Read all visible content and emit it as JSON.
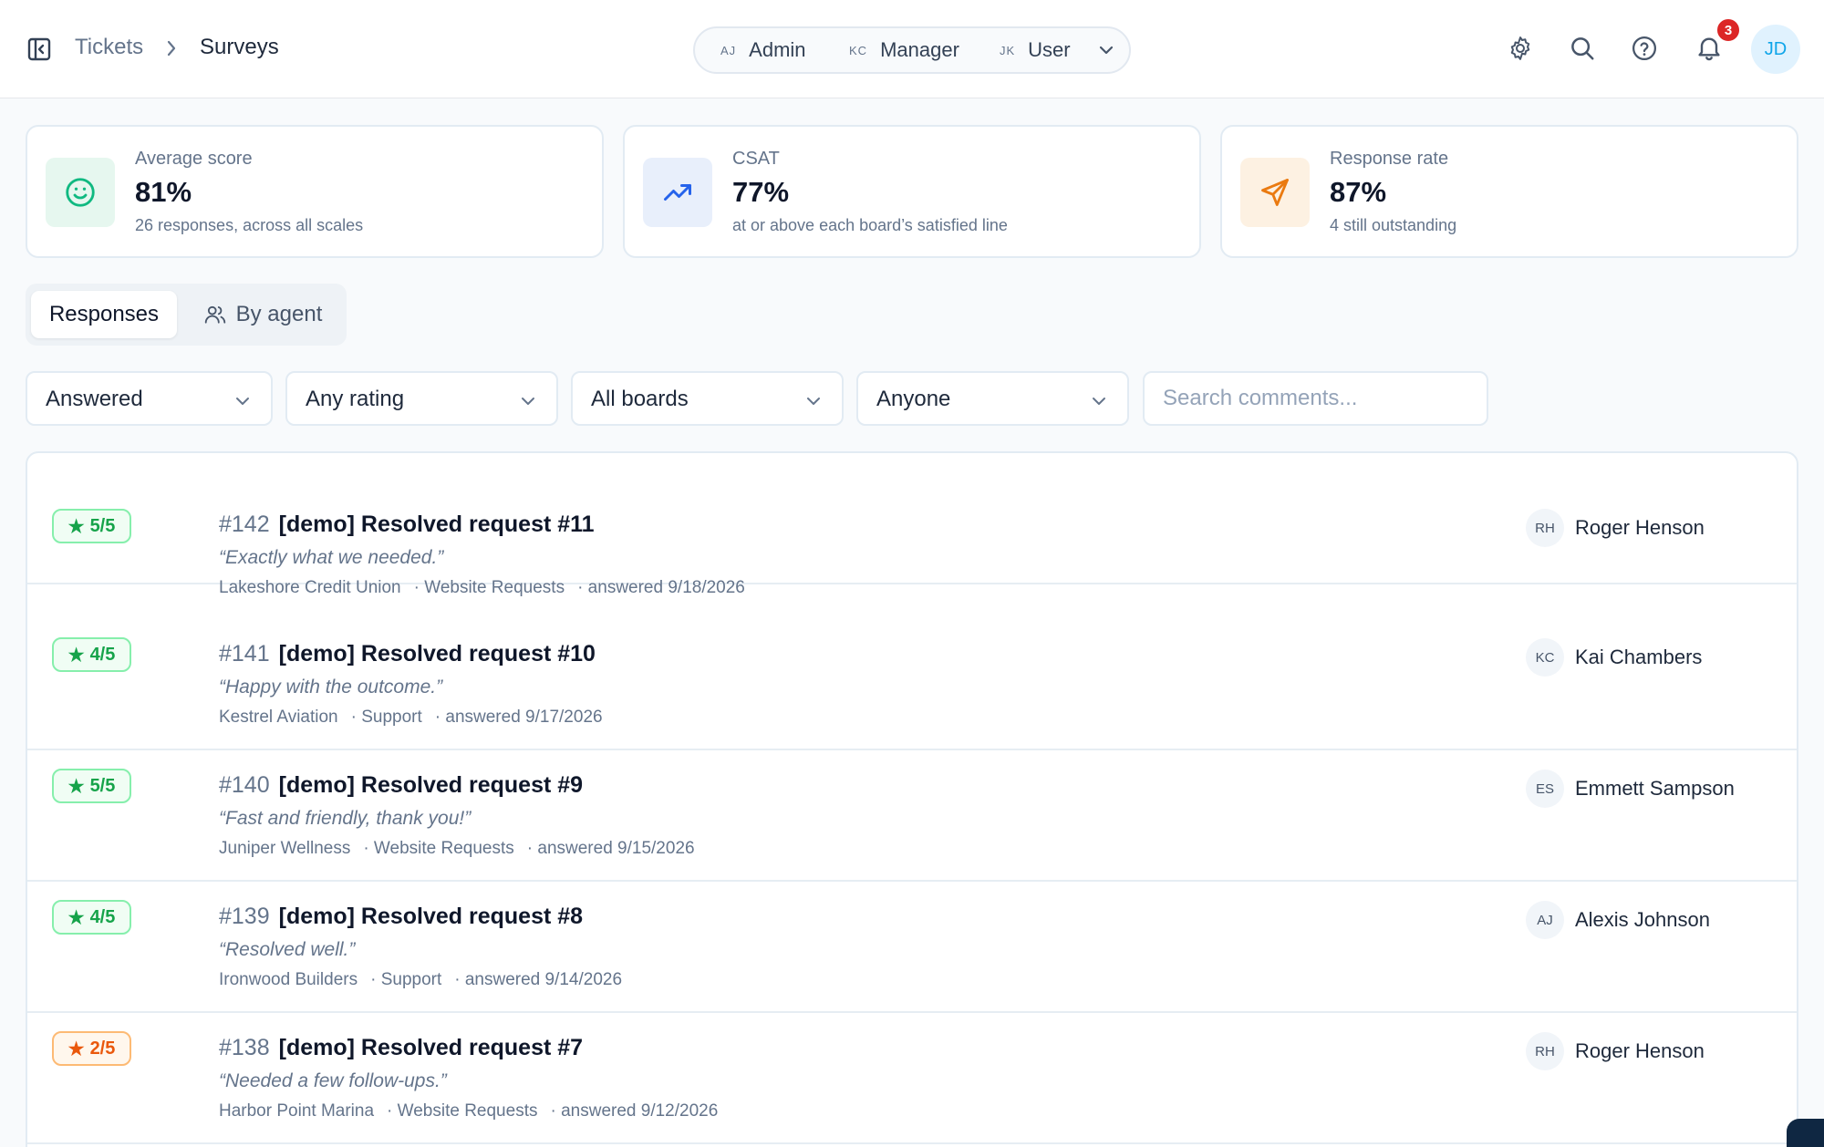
{
  "breadcrumb": {
    "parent": "Tickets",
    "current": "Surveys"
  },
  "roles": [
    {
      "initials": "AJ",
      "label": "Admin"
    },
    {
      "initials": "KC",
      "label": "Manager"
    },
    {
      "initials": "JK",
      "label": "User"
    }
  ],
  "notifications": {
    "count": "3"
  },
  "user": {
    "initials": "JD"
  },
  "stats": [
    {
      "label": "Average score",
      "value": "81%",
      "sub": "26 responses, across all scales",
      "icon": "smile-icon",
      "accent": "#10b981",
      "bg": "#e6f7ef"
    },
    {
      "label": "CSAT",
      "value": "77%",
      "sub": "at or above each board’s satisfied line",
      "icon": "trending-up-icon",
      "accent": "#2563eb",
      "bg": "#e8effb"
    },
    {
      "label": "Response rate",
      "value": "87%",
      "sub": "4 still outstanding",
      "icon": "send-icon",
      "accent": "#ea7a10",
      "bg": "#fdf1e2"
    }
  ],
  "tabs": {
    "active": "Responses",
    "inactive": "By agent"
  },
  "filters": {
    "status": "Answered",
    "rating": "Any rating",
    "board": "All boards",
    "agent": "Anyone",
    "search_placeholder": "Search comments..."
  },
  "responses": [
    {
      "rating": "5/5",
      "tone": "good",
      "number": "#142",
      "subject": "[demo] Resolved request #11",
      "comment": "“Exactly what we needed.”",
      "company": "Lakeshore Credit Union",
      "board": "· Website Requests",
      "answered": "· answered 9/18/2026",
      "agent_initials": "RH",
      "agent": "Roger Henson"
    },
    {
      "rating": "4/5",
      "tone": "good",
      "number": "#141",
      "subject": "[demo] Resolved request #10",
      "comment": "“Happy with the outcome.”",
      "company": "Kestrel Aviation",
      "board": "· Support",
      "answered": "· answered 9/17/2026",
      "agent_initials": "KC",
      "agent": "Kai Chambers"
    },
    {
      "rating": "5/5",
      "tone": "good",
      "number": "#140",
      "subject": "[demo] Resolved request #9",
      "comment": "“Fast and friendly, thank you!”",
      "company": "Juniper Wellness",
      "board": "· Website Requests",
      "answered": "· answered 9/15/2026",
      "agent_initials": "ES",
      "agent": "Emmett Sampson"
    },
    {
      "rating": "4/5",
      "tone": "good",
      "number": "#139",
      "subject": "[demo] Resolved request #8",
      "comment": "“Resolved well.”",
      "company": "Ironwood Builders",
      "board": "· Support",
      "answered": "· answered 9/14/2026",
      "agent_initials": "AJ",
      "agent": "Alexis Johnson"
    },
    {
      "rating": "2/5",
      "tone": "poor",
      "number": "#138",
      "subject": "[demo] Resolved request #7",
      "comment": "“Needed a few follow-ups.”",
      "company": "Harbor Point Marina",
      "board": "· Website Requests",
      "answered": "· answered 9/12/2026",
      "agent_initials": "RH",
      "agent": "Roger Henson"
    }
  ],
  "colors": {
    "good": "#16a34a",
    "good_bg": "#f0fdf4",
    "good_border": "#86efac",
    "poor": "#ea580c",
    "poor_bg": "#fff7ed",
    "poor_border": "#fdba74"
  }
}
